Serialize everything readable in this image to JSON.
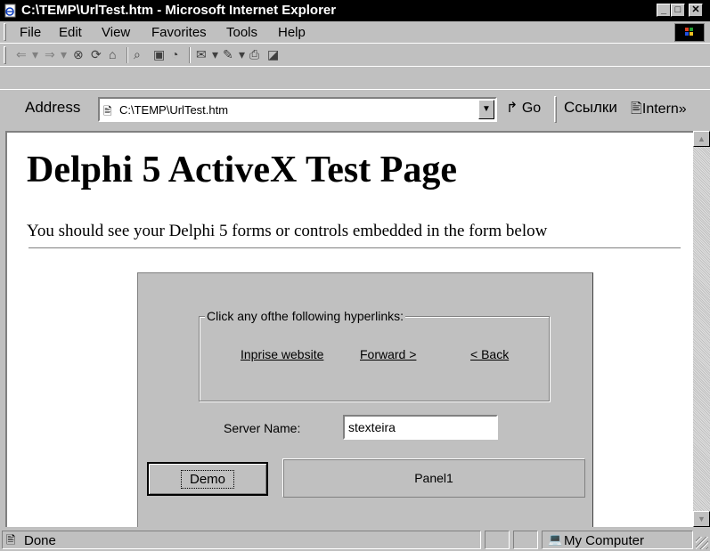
{
  "window": {
    "title": "C:\\TEMP\\UrlTest.htm - Microsoft Internet Explorer",
    "minimize": "_",
    "maximize": "□",
    "close": "✕"
  },
  "menu": {
    "items": [
      {
        "label": "File"
      },
      {
        "label": "Edit"
      },
      {
        "label": "View"
      },
      {
        "label": "Favorites"
      },
      {
        "label": "Tools"
      },
      {
        "label": "Help"
      }
    ]
  },
  "toolbar": {
    "buttons": [
      "back-icon",
      "forward-icon",
      "stop-icon",
      "refresh-icon",
      "home-icon",
      "search-icon",
      "favorites-icon",
      "history-icon",
      "mail-icon",
      "edit-icon",
      "print-icon",
      "discuss-icon"
    ]
  },
  "address": {
    "label": "Address",
    "value": "C:\\TEMP\\UrlTest.htm",
    "go_label": "Go",
    "links_label": "Ссылки",
    "links_item": "Intern",
    "more": "»"
  },
  "page": {
    "title": "Delphi 5 ActiveX Test Page",
    "description": "You should see your Delphi 5 forms or controls embedded in the form below"
  },
  "axform": {
    "group_caption": "Click any ofthe following hyperlinks:",
    "links": [
      {
        "label": "Inprise website"
      },
      {
        "label": "Forward >"
      },
      {
        "label": "< Back"
      }
    ],
    "server_label": "Server Name:",
    "server_value": "stexteira",
    "demo_button": "Demo",
    "panel_caption": "Panel1"
  },
  "status": {
    "text": "Done",
    "zone": "My Computer"
  }
}
